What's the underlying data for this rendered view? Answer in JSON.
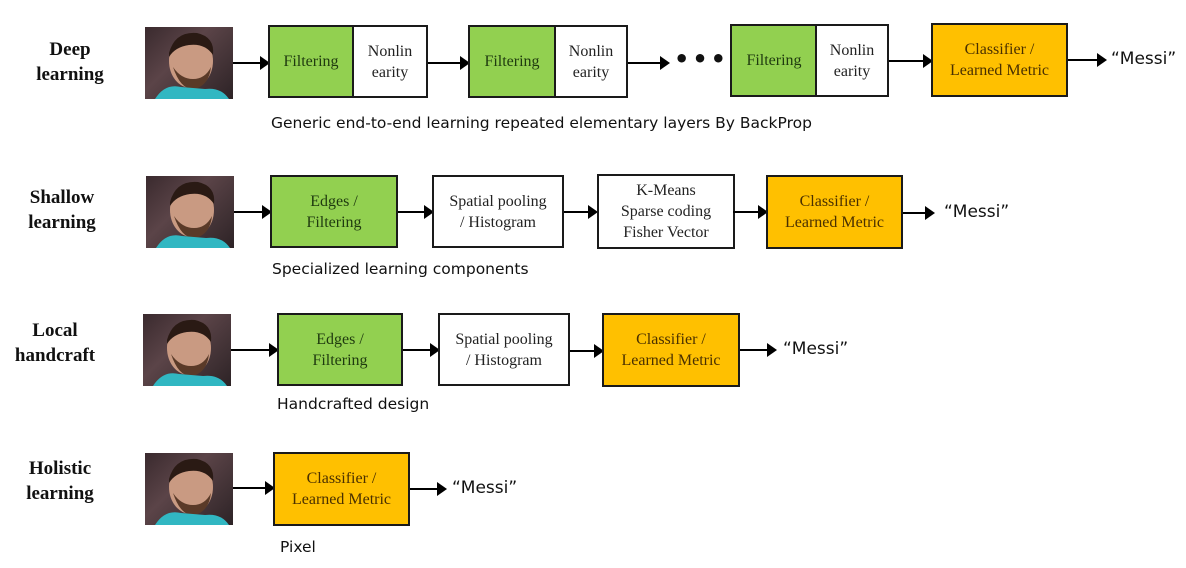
{
  "colors": {
    "feature_box": "#92d050",
    "neutral_box": "#ffffff",
    "classifier_box": "#ffc000",
    "border": "#1a1a1a"
  },
  "rows": [
    {
      "id": "deep",
      "label": "Deep\nlearning",
      "stages": [
        {
          "text": "Filtering",
          "type": "feature"
        },
        {
          "text": "Nonlin\nearity",
          "type": "neutral"
        },
        {
          "text": "Filtering",
          "type": "feature"
        },
        {
          "text": "Nonlin\nearity",
          "type": "neutral"
        },
        {
          "text": "•••",
          "type": "ellipsis"
        },
        {
          "text": "Filtering",
          "type": "feature"
        },
        {
          "text": "Nonlin\nearity",
          "type": "neutral"
        },
        {
          "text": "Classifier /\nLearned Metric",
          "type": "classifier"
        }
      ],
      "output": "“Messi”",
      "caption": "Generic end-to-end learning repeated elementary layers By BackProp"
    },
    {
      "id": "shallow",
      "label": "Shallow\nlearning",
      "stages": [
        {
          "text": "Edges /\nFiltering",
          "type": "feature"
        },
        {
          "text": "Spatial pooling\n/ Histogram",
          "type": "neutral"
        },
        {
          "text": "K-Means\nSparse coding\nFisher Vector",
          "type": "neutral"
        },
        {
          "text": "Classifier /\nLearned Metric",
          "type": "classifier"
        }
      ],
      "output": "“Messi”",
      "caption": "Specialized learning components"
    },
    {
      "id": "local",
      "label": "Local\nhandcraft",
      "stages": [
        {
          "text": "Edges /\nFiltering",
          "type": "feature"
        },
        {
          "text": "Spatial pooling\n/ Histogram",
          "type": "neutral"
        },
        {
          "text": "Classifier /\nLearned Metric",
          "type": "classifier"
        }
      ],
      "output": "“Messi”",
      "caption": "Handcrafted design"
    },
    {
      "id": "holistic",
      "label": "Holistic\nlearning",
      "stages": [
        {
          "text": "Classifier /\nLearned Metric",
          "type": "classifier"
        }
      ],
      "output": "“Messi”",
      "caption": "Pixel"
    }
  ],
  "input_image": {
    "icon": "face-photo-icon"
  }
}
